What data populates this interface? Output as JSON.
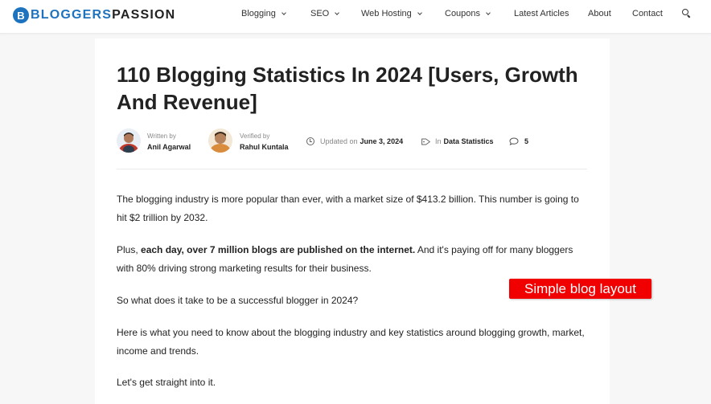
{
  "header": {
    "logo": {
      "mark": "B",
      "part1": "BLOGGERS",
      "part2": "PASSION"
    },
    "nav": [
      {
        "label": "Blogging",
        "has_dropdown": true
      },
      {
        "label": "SEO",
        "has_dropdown": true
      },
      {
        "label": "Web Hosting",
        "has_dropdown": true
      },
      {
        "label": "Coupons",
        "has_dropdown": true
      },
      {
        "label": "Latest Articles",
        "has_dropdown": false
      },
      {
        "label": "About",
        "has_dropdown": false
      },
      {
        "label": "Contact",
        "has_dropdown": false
      }
    ],
    "search_icon": "search-icon"
  },
  "article": {
    "title": "110 Blogging Statistics In 2024 [Users, Growth And Revenue]",
    "meta": {
      "author_label": "Written by",
      "author_name": "Anil Agarwal",
      "verifier_label": "Verified by",
      "verifier_name": "Rahul Kuntala",
      "updated_label": "Updated on",
      "updated_date": "June 3, 2024",
      "category_label": "In",
      "category": "Data Statistics",
      "comments": "5"
    },
    "paragraphs": {
      "p1": "The blogging industry is more popular than ever, with a market size of $413.2 billion. This number is going to hit $2 trillion by 2032.",
      "p2_prefix": "Plus, ",
      "p2_bold": "each day, over 7 million blogs are published on the internet.",
      "p2_suffix": " And it's paying off for many bloggers with 80% driving strong marketing results for their business.",
      "p3": "So what does it take to be a successful blogger in 2024?",
      "p4": "Here is what you need to know about the blogging industry and key statistics around blogging growth, market, income and trends.",
      "p5": "Let's get straight into it."
    }
  },
  "annotation": {
    "label": "Simple blog layout",
    "color": "#f00000"
  },
  "colors": {
    "brand": "#1e73be",
    "text": "#222222",
    "muted": "#888888"
  }
}
